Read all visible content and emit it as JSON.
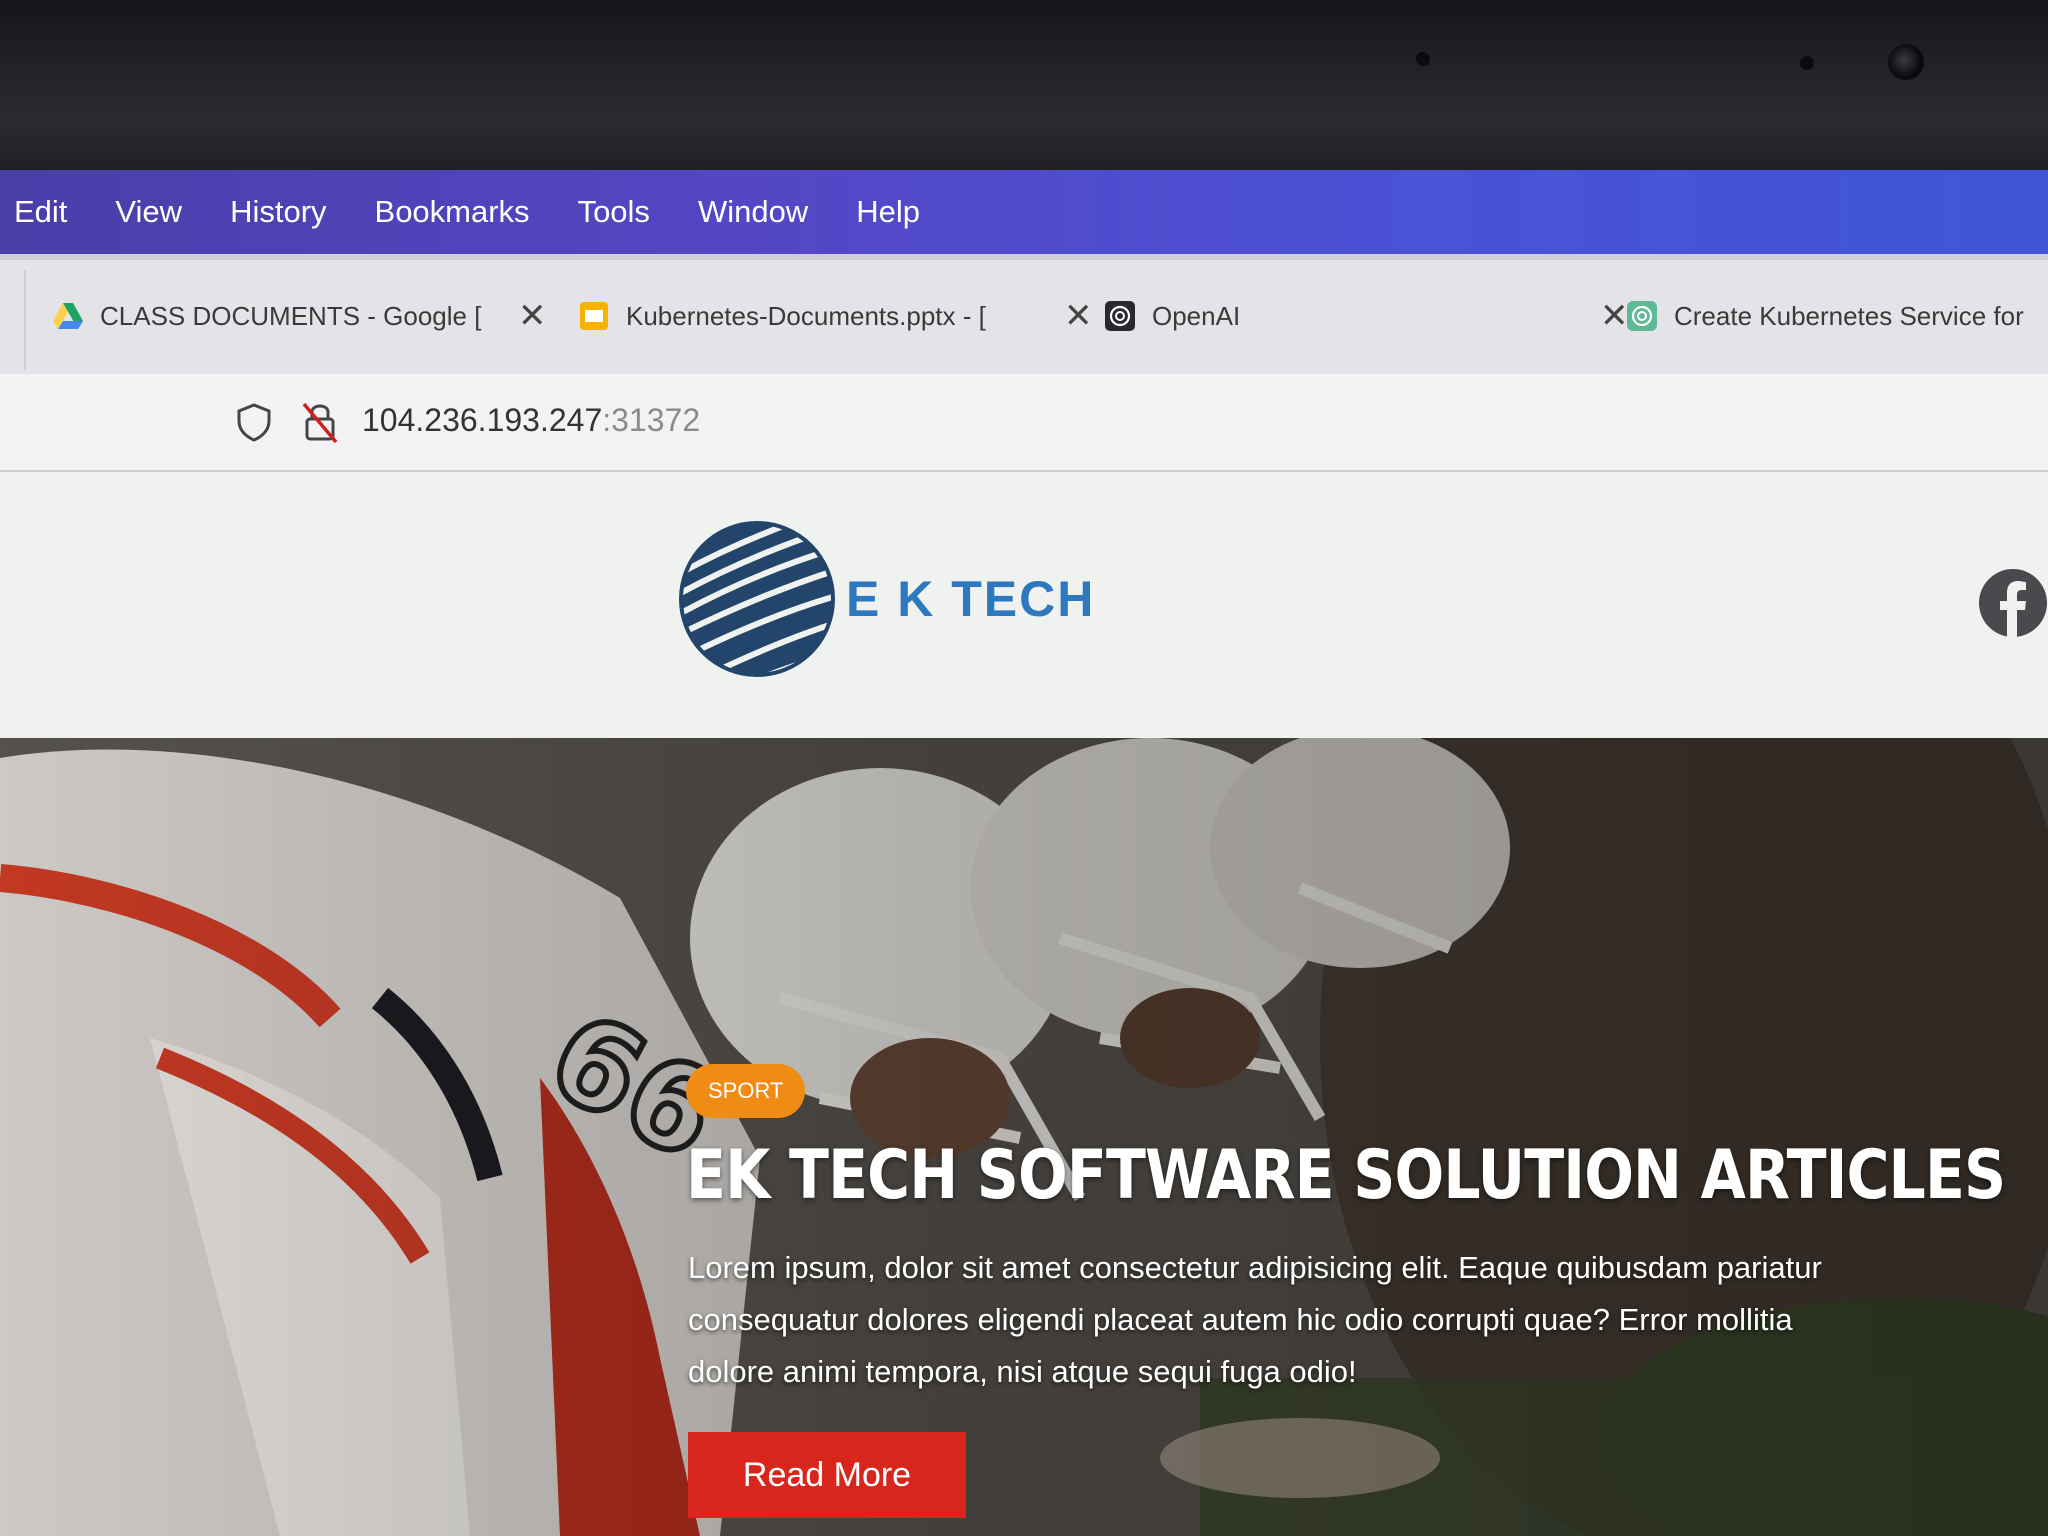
{
  "menu": [
    "Edit",
    "View",
    "History",
    "Bookmarks",
    "Tools",
    "Window",
    "Help"
  ],
  "tabs": [
    {
      "title": "CLASS DOCUMENTS - Google [",
      "icon": "google-drive-icon"
    },
    {
      "title": "Kubernetes-Documents.pptx - [",
      "icon": "slides-icon"
    },
    {
      "title": "OpenAI",
      "icon": "openai-icon"
    },
    {
      "title": "Create Kubernetes Service for",
      "icon": "chatgpt-icon"
    }
  ],
  "url": {
    "host": "104.236.193.247",
    "port": ":31372"
  },
  "site": {
    "logo_text": "E K TECH",
    "social_icon": "facebook-icon"
  },
  "hero": {
    "badge": "SPORT",
    "title": "EK TECH SOFTWARE SOLUTION ARTICLES",
    "body": "Lorem ipsum, dolor sit amet consectetur adipisicing elit. Eaque quibusdam pariatur consequatur dolores eligendi placeat autem hic odio corrupti quae? Error mollitia dolore animi tempora, nisi atque sequi fuga odio!",
    "button": "Read More"
  },
  "colors": {
    "menubar": "#4b3ea8",
    "logo": "#2d78bf",
    "badge": "#f08c14",
    "button": "#d9261c"
  }
}
